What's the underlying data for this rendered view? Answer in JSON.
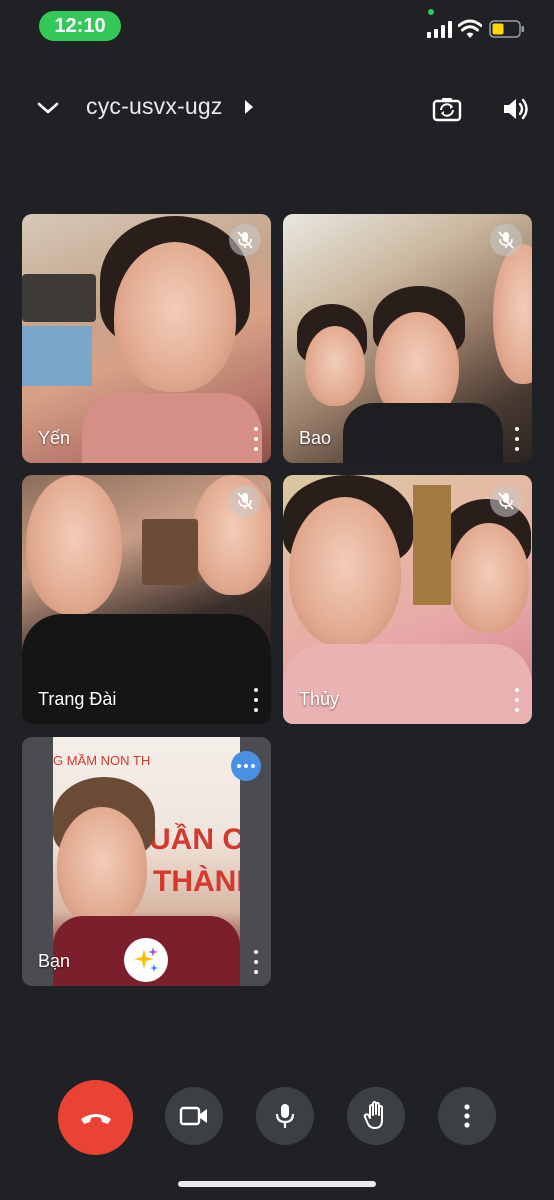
{
  "status_bar": {
    "time": "12:10",
    "icons": [
      "signal-icon",
      "wifi-icon",
      "battery-icon"
    ],
    "accent": "#34c759",
    "battery_color": "#ffd60a"
  },
  "header": {
    "meeting_code": "cyc-usvx-ugz",
    "icons": [
      "chevron-down-icon",
      "caret-right-icon",
      "switch-camera-icon",
      "speaker-icon"
    ]
  },
  "participants": [
    {
      "name": "Yến",
      "muted": true
    },
    {
      "name": "Bao",
      "muted": true
    },
    {
      "name": "Trang Đài",
      "muted": true
    },
    {
      "name": "Thủy",
      "muted": true
    },
    {
      "name": "Bạn",
      "muted": false,
      "self": true
    }
  ],
  "self_tile": {
    "poster_lines": [
      "G MẦM NON TH",
      "UẦN C",
      "THÀNH"
    ]
  },
  "controls": {
    "buttons": [
      "end-call",
      "camera",
      "microphone",
      "raise-hand",
      "more-options"
    ],
    "end_call_color": "#ea4335"
  }
}
